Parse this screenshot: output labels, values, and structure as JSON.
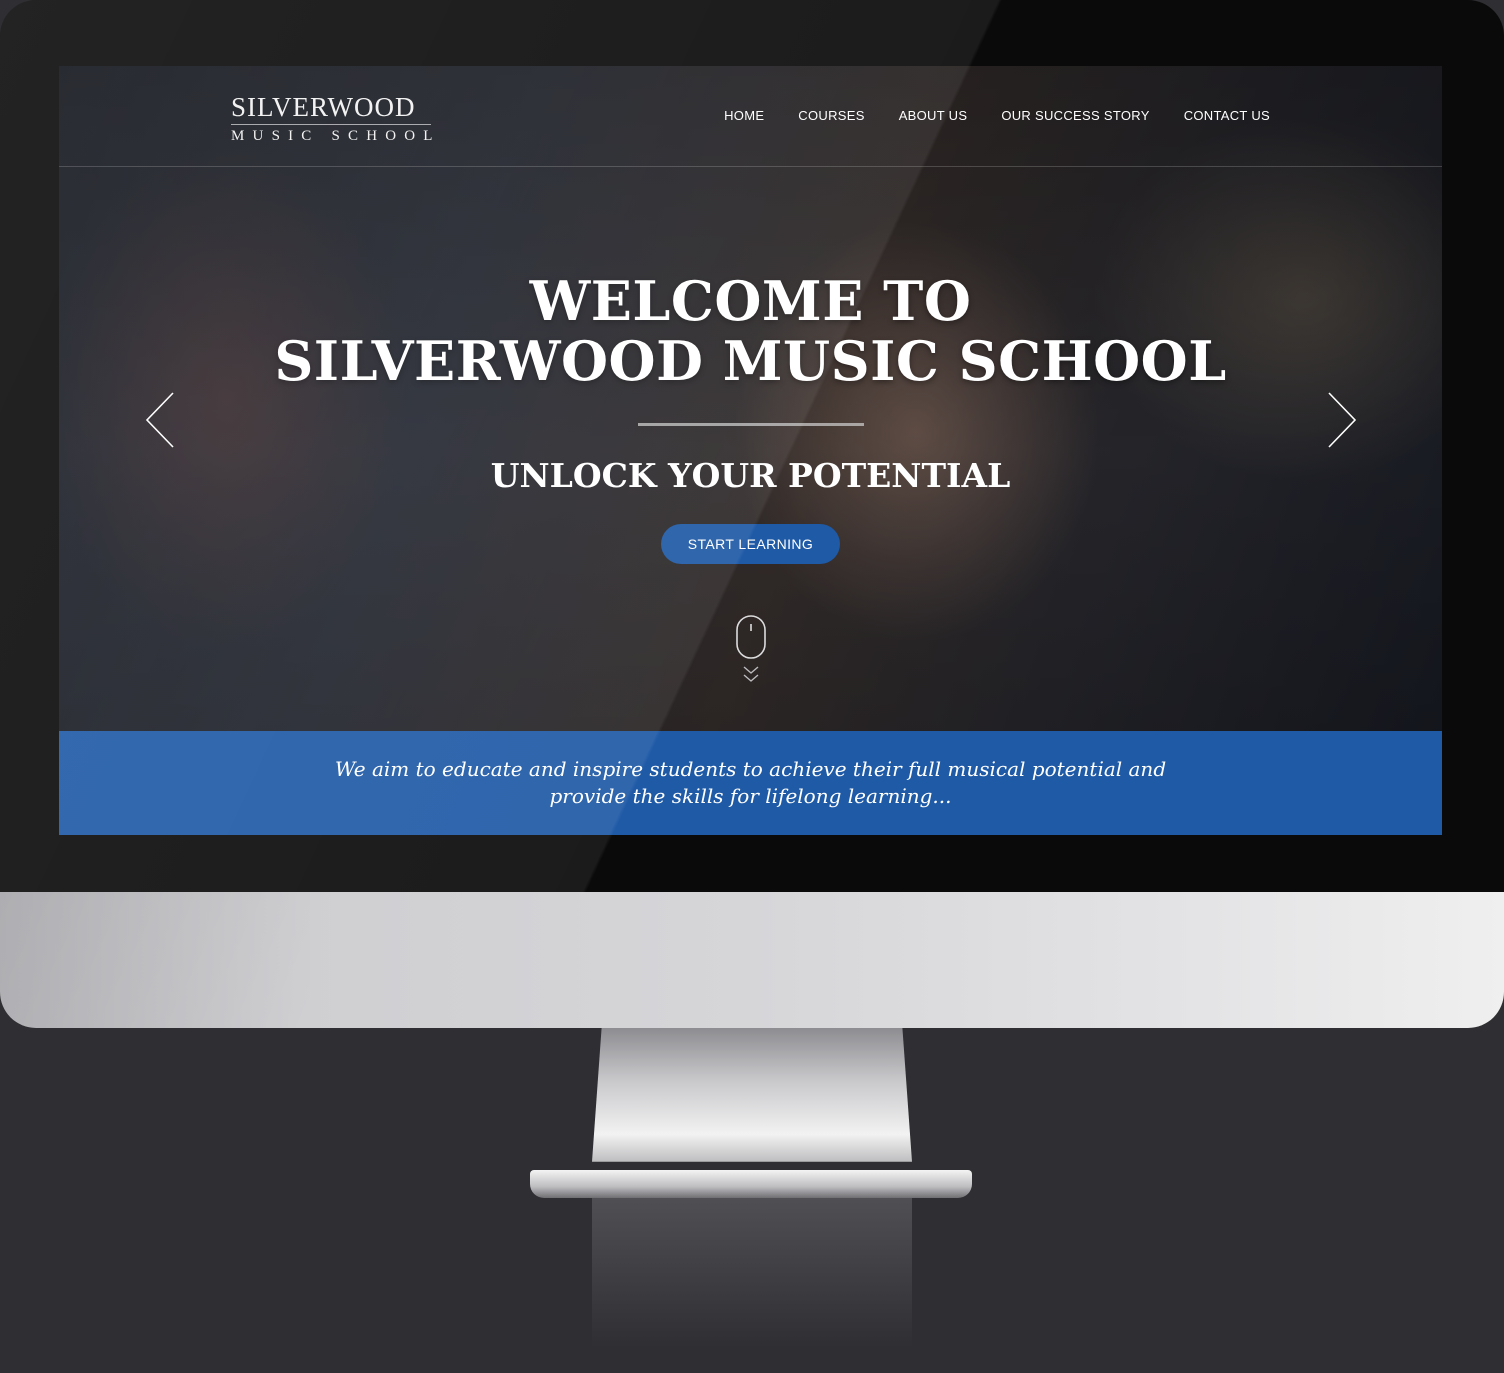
{
  "site": {
    "logo_main": "SILVERWOOD",
    "logo_sub": "MUSIC SCHOOL"
  },
  "nav": {
    "items": [
      {
        "label": "HOME"
      },
      {
        "label": "COURSES"
      },
      {
        "label": "ABOUT US"
      },
      {
        "label": "OUR SUCCESS STORY"
      },
      {
        "label": "CONTACT US"
      }
    ]
  },
  "hero": {
    "title_line1": "WELCOME TO",
    "title_line2": "SILVERWOOD MUSIC SCHOOL",
    "subtitle": "UNLOCK YOUR POTENTIAL",
    "cta_label": "START LEARNING",
    "prev_icon": "chevron-left-icon",
    "next_icon": "chevron-right-icon",
    "scroll_icon": "mouse-scroll-icon"
  },
  "banner": {
    "text": "We aim to educate and inspire students to achieve their full musical potential and provide the skills for lifelong learning..."
  },
  "colors": {
    "accent": "#1f5aa6",
    "background": "#2f2f33"
  }
}
